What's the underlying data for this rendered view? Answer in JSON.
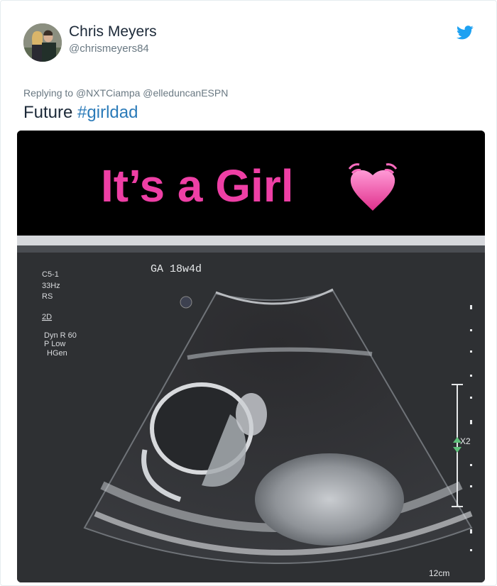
{
  "tweet": {
    "author": {
      "display_name": "Chris Meyers",
      "handle": "@chrismeyers84"
    },
    "reply_prefix": "Replying to",
    "reply_mentions": [
      "@NXTCiampa",
      "@elleduncanESPN"
    ],
    "text": "Future",
    "hashtag": "#girldad",
    "icons": {
      "platform": "twitter-bird-icon",
      "heart": "heart-emoji-icon"
    },
    "colors": {
      "link": "#2b7bb9",
      "brand": "#1da1f2",
      "overlay_text": "#ee3fa5"
    }
  },
  "media": {
    "overlay_caption": "It’s a Girl",
    "scan": {
      "gestational_age": "GA 18w4d",
      "settings": [
        "C5-1",
        "33Hz",
        "RS",
        "2D",
        "Dyn R 60",
        "P Low",
        "HGen"
      ],
      "caliper_label": "X2",
      "depth_label": "12cm"
    }
  }
}
